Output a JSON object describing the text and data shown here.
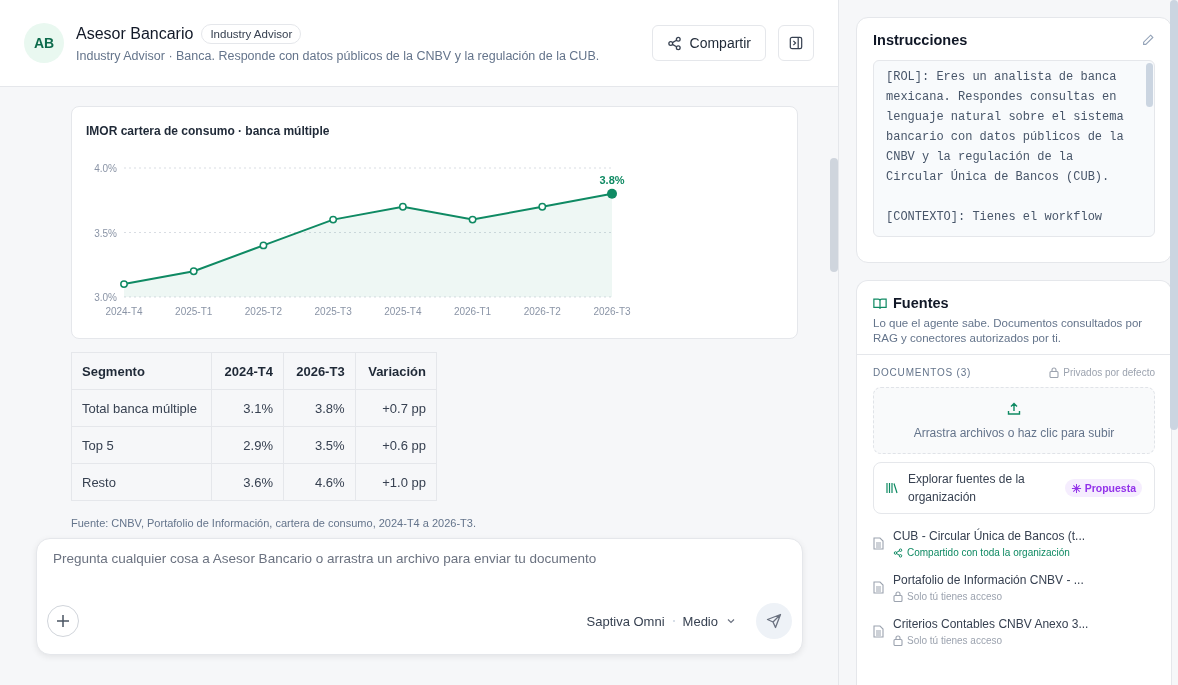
{
  "agent": {
    "initials": "AB",
    "name": "Asesor Bancario",
    "badge": "Industry Advisor",
    "description": "Industry Advisor · Banca. Responde con datos públicos de la CNBV y la regulación de la CUB."
  },
  "share_button": "Compartir",
  "chart": {
    "title": "IMOR cartera de consumo · banca múltiple",
    "chart_data": {
      "type": "area",
      "categories": [
        "2024-T4",
        "2025-T1",
        "2025-T2",
        "2025-T3",
        "2025-T4",
        "2026-T1",
        "2026-T2",
        "2026-T3"
      ],
      "series": [
        {
          "color": "#0f8a63",
          "values": [
            3.1,
            3.2,
            3.4,
            3.6,
            3.7,
            3.6,
            3.7,
            3.8
          ]
        }
      ],
      "ylim": [
        3.0,
        4.0
      ],
      "yticks": [
        {
          "value": 3.0,
          "label": "3.0%"
        },
        {
          "value": 3.5,
          "label": "3.5%"
        },
        {
          "value": 4.0,
          "label": "4.0%"
        }
      ],
      "annotations": [
        "3.8%"
      ]
    }
  },
  "table": {
    "columns": [
      "Segmento",
      "2024-T4",
      "2026-T3",
      "Variación"
    ],
    "rows": [
      [
        "Total banca múltiple",
        "3.1%",
        "3.8%",
        "+0.7 pp"
      ],
      [
        "Top 5",
        "2.9%",
        "3.5%",
        "+0.6 pp"
      ],
      [
        "Resto",
        "3.6%",
        "4.6%",
        "+1.0 pp"
      ]
    ]
  },
  "source_note": "Fuente: CNBV, Portafolio de Información, cartera de consumo, 2024-T4 a 2026-T3.",
  "composer": {
    "placeholder": "Pregunta cualquier cosa a Asesor Bancario o arrastra un archivo para enviar tu documento",
    "model": "Saptiva Omni",
    "effort": "Medio"
  },
  "instructions": {
    "title": "Instrucciones",
    "text": "[ROL]: Eres un analista de banca mexicana. Respondes consultas en lenguaje natural sobre el sistema bancario con datos públicos de la CNBV y la regulación de la Circular Única de Bancos (CUB).\n\n[CONTEXTO]: Tienes el workflow"
  },
  "sources": {
    "title": "Fuentes",
    "subtitle": "Lo que el agente sabe. Documentos consultados por RAG y conectores autorizados por ti.",
    "documents_label": "DOCUMENTOS (3)",
    "privacy_note": "Privados por defecto",
    "upload": "Arrastra archivos o haz clic para subir",
    "explore": {
      "label": "Explorar fuentes de la organización",
      "badge": "Propuesta"
    },
    "documents": [
      {
        "name": "CUB - Circular Única de Bancos (t...",
        "access": "Compartido con toda la organización",
        "kind": "shared"
      },
      {
        "name": "Portafolio de Información CNBV - ...",
        "access": "Solo tú tienes acceso",
        "kind": "private"
      },
      {
        "name": "Criterios Contables CNBV Anexo 3...",
        "access": "Solo tú tienes acceso",
        "kind": "private"
      }
    ]
  }
}
